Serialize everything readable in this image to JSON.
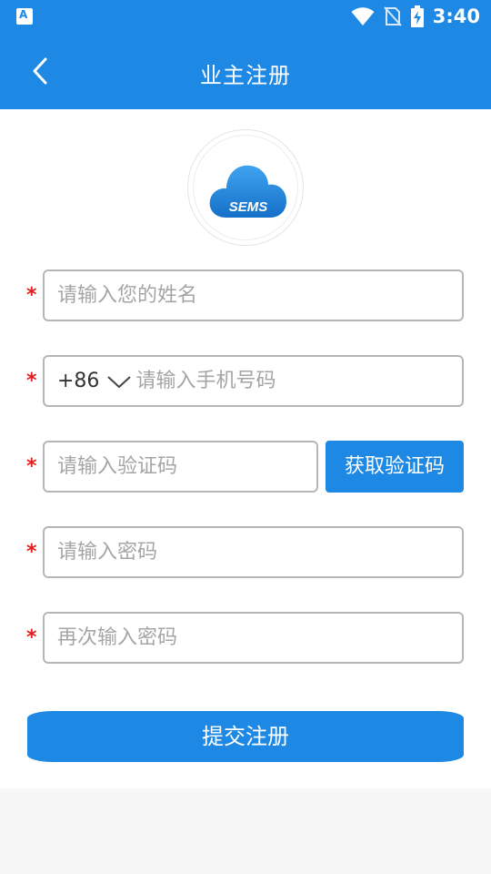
{
  "status_bar": {
    "time": "3:40",
    "icons": [
      "app-notification-icon",
      "wifi-icon",
      "no-sim-icon",
      "battery-charging-icon"
    ]
  },
  "app_bar": {
    "title": "业主注册",
    "back_icon": "chevron-left-icon"
  },
  "logo": {
    "text": "SEMS",
    "icon": "cloud-icon"
  },
  "form": {
    "required_marker": "*",
    "name": {
      "placeholder": "请输入您的姓名",
      "value": ""
    },
    "phone": {
      "country_code": "+86",
      "placeholder": "请输入手机号码",
      "value": ""
    },
    "verify_code": {
      "placeholder": "请输入验证码",
      "value": "",
      "button_label": "获取验证码"
    },
    "password": {
      "placeholder": "请输入密码",
      "value": ""
    },
    "password_confirm": {
      "placeholder": "再次输入密码",
      "value": ""
    },
    "submit_label": "提交注册"
  },
  "colors": {
    "primary": "#1e88e5",
    "required": "#e02020",
    "border": "#b6b6b6",
    "background": "#f7f7f7"
  }
}
